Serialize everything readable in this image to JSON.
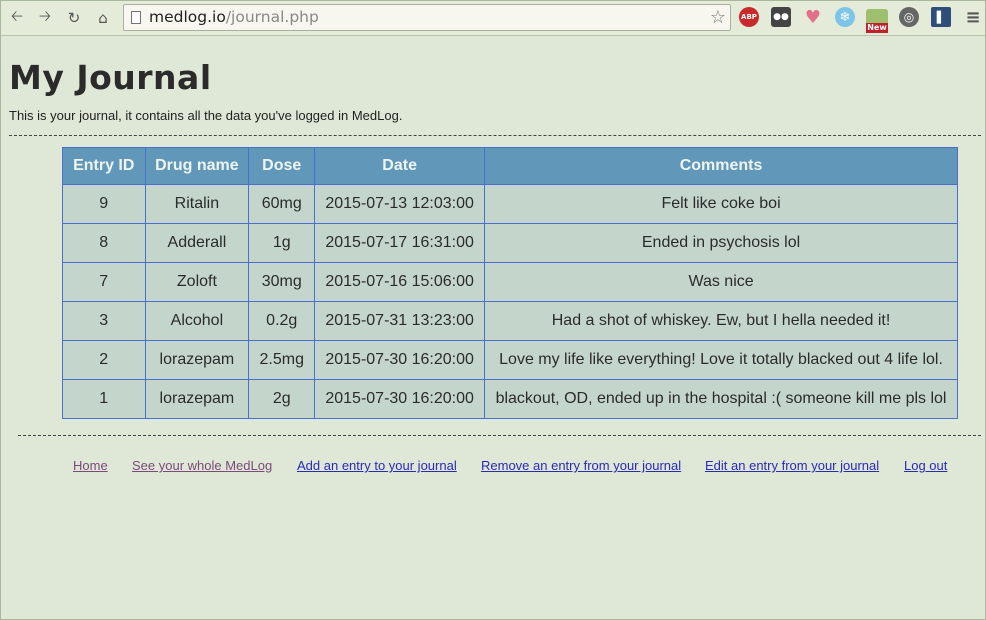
{
  "browser": {
    "url_host": "medlog.io",
    "url_path": "/journal.php",
    "extension_abp_label": "ABP",
    "extension_new_badge": "New"
  },
  "page": {
    "title": "My Journal",
    "intro": "This is your journal, it contains all the data you've logged in MedLog."
  },
  "table": {
    "headers": [
      "Entry ID",
      "Drug name",
      "Dose",
      "Date",
      "Comments"
    ],
    "rows": [
      [
        "9",
        "Ritalin",
        "60mg",
        "2015-07-13 12:03:00",
        "Felt like coke boi"
      ],
      [
        "8",
        "Adderall",
        "1g",
        "2015-07-17 16:31:00",
        "Ended in psychosis lol"
      ],
      [
        "7",
        "Zoloft",
        "30mg",
        "2015-07-16 15:06:00",
        "Was nice"
      ],
      [
        "3",
        "Alcohol",
        "0.2g",
        "2015-07-31 13:23:00",
        "Had a shot of whiskey. Ew, but I hella needed it!"
      ],
      [
        "2",
        "lorazepam",
        "2.5mg",
        "2015-07-30 16:20:00",
        "Love my life like everything! Love it totally blacked out 4 life lol."
      ],
      [
        "1",
        "lorazepam",
        "2g",
        "2015-07-30 16:20:00",
        "blackout, OD, ended up in the hospital :( someone kill me pls lol"
      ]
    ]
  },
  "footer": {
    "links": [
      {
        "label": "Home",
        "visited": true
      },
      {
        "label": "See your whole MedLog",
        "visited": true
      },
      {
        "label": "Add an entry to your journal",
        "visited": false
      },
      {
        "label": "Remove an entry from your journal",
        "visited": false
      },
      {
        "label": "Edit an entry from your journal",
        "visited": false
      },
      {
        "label": "Log out",
        "visited": false
      }
    ]
  },
  "colors": {
    "page_background": "#dfe8d6",
    "table_header": "#6197b8",
    "table_cell": "#c4d6cc",
    "table_border": "#4a6fd0",
    "visited_link": "#7b4a7a",
    "unvisited_link": "#2a2ab8"
  }
}
